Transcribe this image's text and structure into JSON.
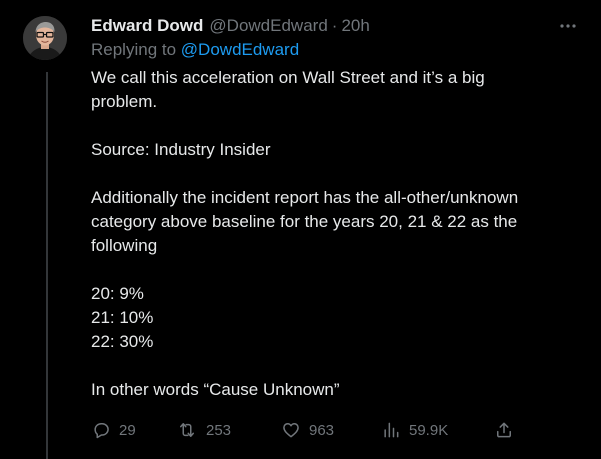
{
  "tweet": {
    "author": {
      "display_name": "Edward Dowd",
      "handle": "@DowdEdward",
      "separator": "·",
      "time": "20h"
    },
    "replying_to": {
      "prefix": "Replying to",
      "handle": "@DowdEdward"
    },
    "paragraphs": [
      [
        "We call this acceleration on Wall Street and it’s a big",
        "problem."
      ],
      [
        "Source: Industry Insider"
      ],
      [
        "Additionally the incident report has the all-other/unknown",
        "category above baseline for the years 20, 21 & 22 as the",
        "following"
      ],
      [
        "20: 9%",
        "21: 10%",
        "22: 30%"
      ],
      [
        "In other words “Cause Unknown”"
      ]
    ],
    "actions": {
      "replies": "29",
      "retweets": "253",
      "likes": "963",
      "views": "59.9K"
    }
  },
  "icons": {
    "more": "more-horizontal-icon",
    "reply": "reply-bubble-icon",
    "retweet": "retweet-icon",
    "like": "heart-icon",
    "views": "bar-chart-views-icon",
    "share": "share-upload-icon"
  },
  "colors": {
    "background": "#000000",
    "text": "#e7e9ea",
    "muted": "#71767b",
    "link": "#1d9bf0",
    "thread_line": "#333639"
  }
}
